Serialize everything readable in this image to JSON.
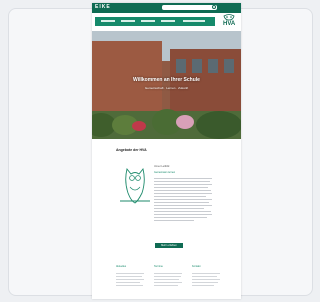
{
  "site": {
    "brand": "EIKE",
    "logo_text": "HVA",
    "hero_title": "Willkommen an Ihrer Schule",
    "hero_subtitle": "Gemeinschaft · Lernen · Zukunft",
    "section_title": "Angebote der HVA",
    "col_head": "Unser Leitbild",
    "col_accent": "Gemeinsam lernen",
    "cta_label": "Mehr erfahren",
    "footer_headings": [
      "Aktuelles",
      "Termine",
      "Kontakt"
    ]
  },
  "colors": {
    "primary": "#0f6b53",
    "nav": "#168a6b"
  },
  "icons": {
    "logo": "owl-logo-icon",
    "search": "search-icon",
    "illustration": "owl-illustration-icon"
  }
}
